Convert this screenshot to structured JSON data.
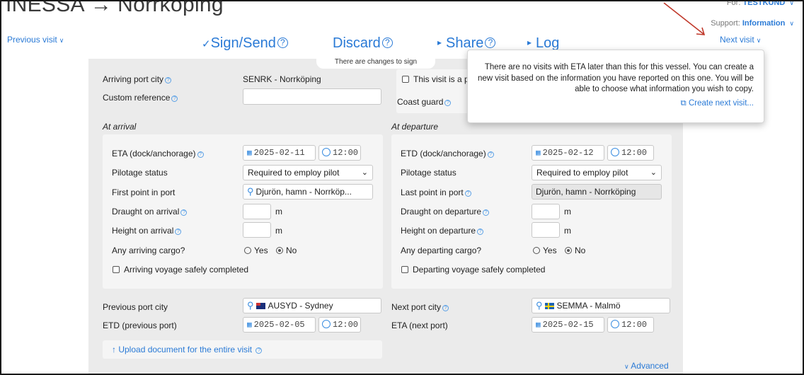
{
  "header": {
    "title_left": "INESSA",
    "title_arrow": "→",
    "title_right": "Norrköping",
    "for_label": "For:",
    "for_value": "TESTKUND",
    "support_label": "Support:",
    "support_value": "Information"
  },
  "nav": {
    "previous_visit": "Previous visit",
    "next_visit": "Next visit",
    "chevron": "∨"
  },
  "actions": {
    "sign_check": "✓",
    "sign": "Sign/Send",
    "discard": "Discard",
    "share_caret": "▸",
    "share": "Share",
    "log_caret": "▸",
    "log": "Log",
    "help": "?",
    "changes_notice": "There are changes to sign"
  },
  "popup": {
    "text": "There are no visits with ETA later than this for this vessel. You can create a new visit based on the information you have reported on this one. You will be able to choose what information you wish to copy.",
    "link_icon": "⧉",
    "link": "Create next visit..."
  },
  "top": {
    "arriving_port_city_label": "Arriving port city",
    "arriving_port_city_value": "SENRK - Norrköping",
    "custom_reference_label": "Custom reference",
    "custom_reference_value": "",
    "this_visit_label": "This visit is a p",
    "coast_guard_label": "Coast guard"
  },
  "arrival": {
    "section": "At arrival",
    "eta_label": "ETA (dock/anchorage)",
    "eta_date": "2025-02-11",
    "eta_time": "12:00",
    "pilotage_label": "Pilotage status",
    "pilotage_value": "Required to employ pilot",
    "first_point_label": "First point in port",
    "first_point_value": "Djurön, hamn - Norrköp...",
    "draught_label": "Draught on arrival",
    "draught_unit": "m",
    "height_label": "Height on arrival",
    "height_unit": "m",
    "cargo_label": "Any arriving cargo?",
    "yes": "Yes",
    "no": "No",
    "completed_label": "Arriving voyage safely completed"
  },
  "departure": {
    "section": "At departure",
    "etd_label": "ETD (dock/anchorage)",
    "etd_date": "2025-02-12",
    "etd_time": "12:00",
    "pilotage_label": "Pilotage status",
    "pilotage_value": "Required to employ pilot",
    "last_point_label": "Last point in port",
    "last_point_value": "Djurön, hamn - Norrköping",
    "draught_label": "Draught on departure",
    "draught_unit": "m",
    "height_label": "Height on departure",
    "height_unit": "m",
    "cargo_label": "Any departing cargo?",
    "yes": "Yes",
    "no": "No",
    "completed_label": "Departing voyage safely completed"
  },
  "ports": {
    "previous_label": "Previous port city",
    "previous_value": "AUSYD - Sydney",
    "etd_prev_label": "ETD (previous port)",
    "etd_prev_date": "2025-02-05",
    "etd_prev_time": "12:00",
    "next_label": "Next port city",
    "next_value": "SEMMA - Malmö",
    "eta_next_label": "ETA (next port)",
    "eta_next_date": "2025-02-15",
    "eta_next_time": "12:00"
  },
  "footer": {
    "upload_arrow": "↑",
    "upload": "Upload document for the entire visit",
    "advanced": "Advanced"
  },
  "icons": {
    "calendar": "calendar-icon",
    "clock": "clock-icon",
    "search": "search-icon",
    "help": "help-circle-icon"
  },
  "colors": {
    "link": "#2a7ad6",
    "panel": "#ebebeb",
    "box": "#f5f5f5",
    "annotation_arrow": "#c0392b"
  }
}
